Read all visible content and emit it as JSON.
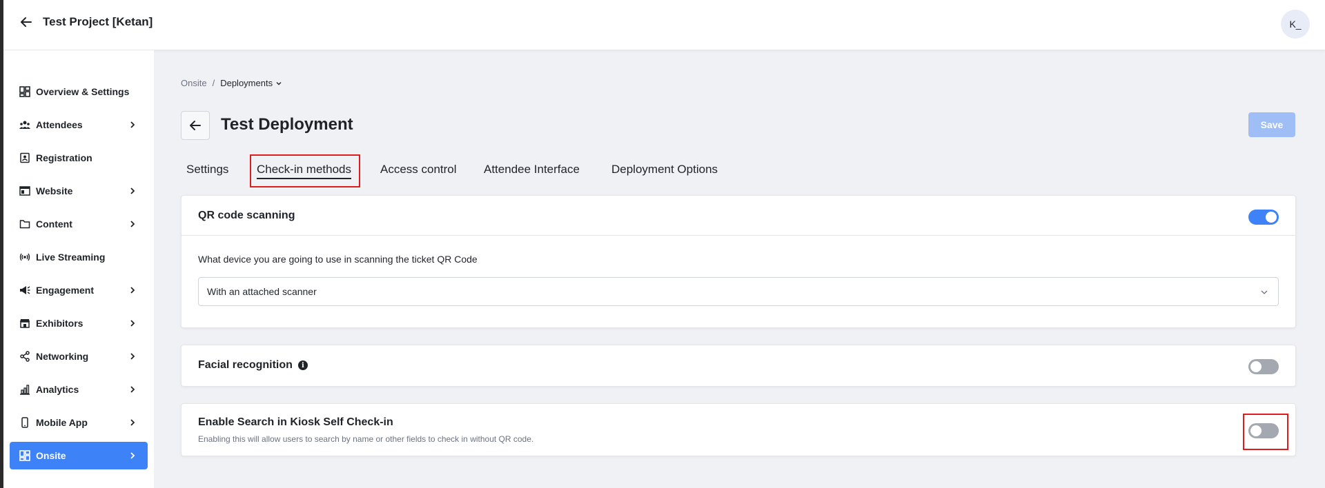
{
  "header": {
    "project_title": "Test Project [Ketan]",
    "avatar_initials": "K_"
  },
  "sidebar": {
    "items": [
      {
        "label": "Overview & Settings",
        "icon": "dashboard-icon",
        "has_children": false,
        "active": false
      },
      {
        "label": "Attendees",
        "icon": "people-icon",
        "has_children": true,
        "active": false
      },
      {
        "label": "Registration",
        "icon": "id-card-icon",
        "has_children": false,
        "active": false
      },
      {
        "label": "Website",
        "icon": "browser-icon",
        "has_children": true,
        "active": false
      },
      {
        "label": "Content",
        "icon": "folder-icon",
        "has_children": true,
        "active": false
      },
      {
        "label": "Live Streaming",
        "icon": "broadcast-icon",
        "has_children": false,
        "active": false
      },
      {
        "label": "Engagement",
        "icon": "megaphone-icon",
        "has_children": true,
        "active": false
      },
      {
        "label": "Exhibitors",
        "icon": "store-icon",
        "has_children": true,
        "active": false
      },
      {
        "label": "Networking",
        "icon": "share-icon",
        "has_children": true,
        "active": false
      },
      {
        "label": "Analytics",
        "icon": "bar-chart-icon",
        "has_children": true,
        "active": false
      },
      {
        "label": "Mobile App",
        "icon": "mobile-icon",
        "has_children": true,
        "active": false
      },
      {
        "label": "Onsite",
        "icon": "dashboard-icon",
        "has_children": true,
        "active": true
      }
    ]
  },
  "breadcrumb": {
    "parent": "Onsite",
    "separator": "/",
    "current": "Deployments"
  },
  "page": {
    "title": "Test Deployment",
    "save_label": "Save"
  },
  "tabs": [
    {
      "label": "Settings",
      "active": false
    },
    {
      "label": "Check-in methods",
      "active": true
    },
    {
      "label": "Access control",
      "active": false
    },
    {
      "label": "Attendee Interface",
      "active": false
    },
    {
      "label": "Deployment Options",
      "active": false
    }
  ],
  "qr_section": {
    "title": "QR code scanning",
    "enabled": true,
    "question": "What device you are going to use in scanning the ticket QR Code",
    "selected_device": "With an attached scanner"
  },
  "facial_section": {
    "title": "Facial recognition",
    "info_glyph": "i",
    "enabled": false
  },
  "kiosk_section": {
    "title": "Enable Search in Kiosk Self Check-in",
    "description": "Enabling this will allow users to search by name or other fields to check in without QR code.",
    "enabled": false
  },
  "colors": {
    "accent": "#3e82f7",
    "save_disabled": "#9ebef5",
    "toggle_off": "#a3a8b1",
    "highlight": "#e01b1b"
  }
}
